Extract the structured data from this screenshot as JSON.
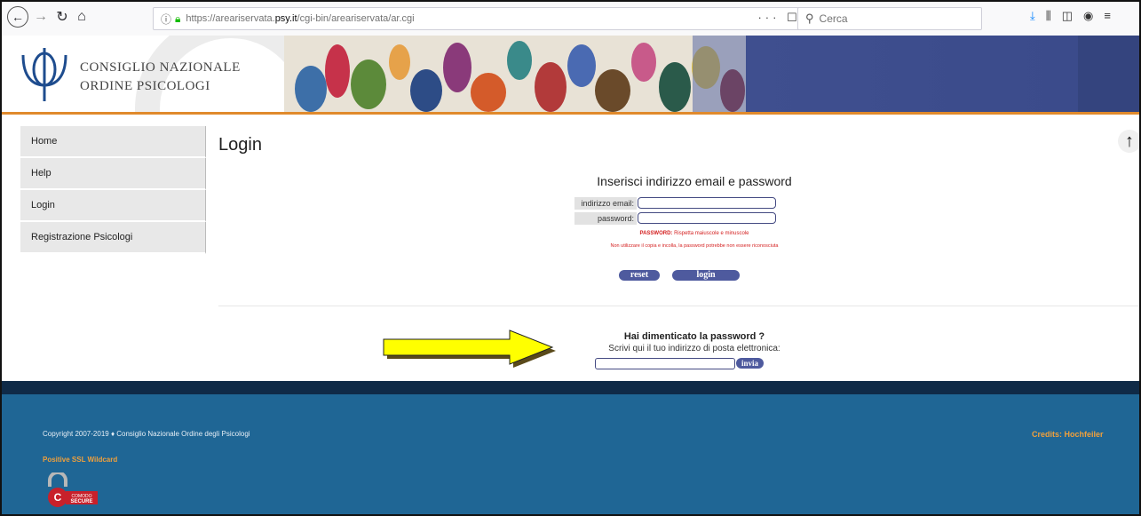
{
  "browser": {
    "url_prefix": "https://areariservata.",
    "url_domain": "psy.it",
    "url_path": "/cgi-bin/areariservata/ar.cgi",
    "url_actions": "··· ☐ ☆",
    "search_placeholder": "Cerca"
  },
  "site": {
    "logo_line1": "CONSIGLIO NAZIONALE",
    "logo_line2": "ORDINE PSICOLOGI"
  },
  "sidebar": {
    "items": [
      {
        "label": "Home"
      },
      {
        "label": "Help"
      },
      {
        "label": "Login"
      },
      {
        "label": "Registrazione Psicologi"
      }
    ]
  },
  "main": {
    "title": "Login",
    "login_heading": "Inserisci indirizzo email e password",
    "email_label": "indirizzo email:",
    "password_label": "password:",
    "notice_bold": "PASSWORD:",
    "notice_rest": " Rispetta maiuscole e minuscole",
    "notice2": "Non utilizzare il copia e incolla, la password potrebbe non essere riconosciuta",
    "reset_label": "reset",
    "login_label": "login",
    "forgot_title": "Hai dimenticato la password ?",
    "forgot_sub": "Scrivi qui il tuo indirizzo di posta elettronica:",
    "invia_label": "invia"
  },
  "footer": {
    "copyright": "Copyright 2007-2019  ♦  Consiglio Nazionale Ordine degli Psicologi",
    "ssl": "Positive SSL Wildcard",
    "credits": "Credits: Hochfeiler",
    "comodo_line1": "COMODO",
    "comodo_line2": "SECURE"
  },
  "colors": {
    "accent_orange": "#e08a2c",
    "footer_blue": "#1f6695",
    "button_blue": "#4e5a9e",
    "notice_red": "#d42020",
    "annotation_yellow": "#ffff00"
  }
}
